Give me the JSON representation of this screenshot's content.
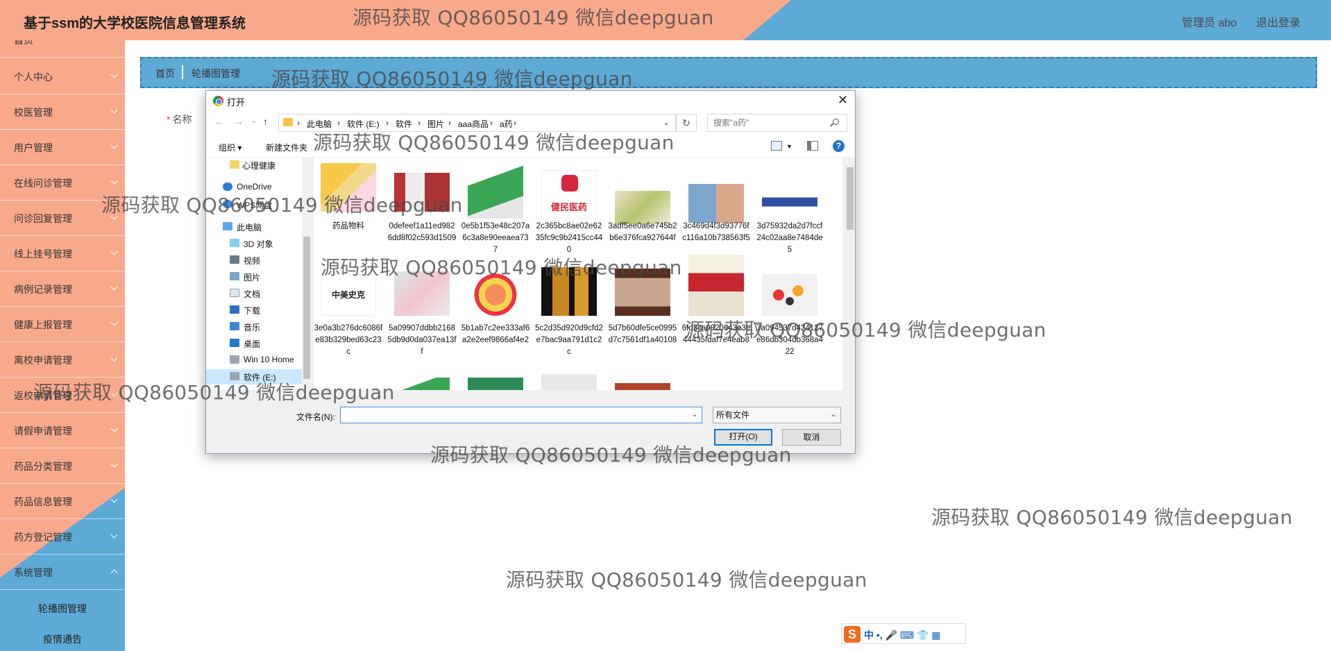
{
  "header": {
    "title": "基于ssm的大学校医院信息管理系统",
    "user": "管理员 abo",
    "logout": "退出登录"
  },
  "sidebar": {
    "items": [
      {
        "label": "首页"
      },
      {
        "label": "个人中心"
      },
      {
        "label": "校医管理"
      },
      {
        "label": "用户管理"
      },
      {
        "label": "在线问诊管理"
      },
      {
        "label": "问诊回复管理"
      },
      {
        "label": "线上挂号管理"
      },
      {
        "label": "病例记录管理"
      },
      {
        "label": "健康上报管理"
      },
      {
        "label": "离校申请管理"
      },
      {
        "label": "返校申请管理"
      },
      {
        "label": "请假申请管理"
      },
      {
        "label": "药品分类管理"
      },
      {
        "label": "药品信息管理"
      },
      {
        "label": "药方登记管理"
      },
      {
        "label": "系统管理"
      }
    ],
    "subitems": [
      {
        "label": "轮播图管理"
      },
      {
        "label": "疫情通告"
      }
    ]
  },
  "breadcrumb": {
    "home": "首页",
    "current": "轮播图管理"
  },
  "form": {
    "name_label": "名称",
    "required_mark": "*"
  },
  "dialog": {
    "title": "打开",
    "close": "✕",
    "nav": {
      "back": "←",
      "forward": "→",
      "recent": "⌄",
      "up": "↑"
    },
    "address": [
      "此电脑",
      "软件 (E:)",
      "软件",
      "图片",
      "aaa商品",
      "a药"
    ],
    "address_sep": "›",
    "refresh": "↻",
    "search_placeholder": "搜索\"a药\"",
    "toolbar": {
      "organize": "组织 ▾",
      "new_folder": "新建文件夹",
      "help": "?"
    },
    "tree": [
      {
        "label": "心理健康",
        "icon": "folder-icon"
      },
      {
        "label": "OneDrive",
        "icon": "cloud-icon"
      },
      {
        "label": "WPS网盘",
        "icon": "cloud-icon"
      },
      {
        "label": "此电脑",
        "icon": "computer-icon"
      },
      {
        "label": "3D 对象",
        "icon": "cube-icon"
      },
      {
        "label": "视频",
        "icon": "video-icon"
      },
      {
        "label": "图片",
        "icon": "image-icon"
      },
      {
        "label": "文档",
        "icon": "document-icon"
      },
      {
        "label": "下载",
        "icon": "download-icon"
      },
      {
        "label": "音乐",
        "icon": "music-icon"
      },
      {
        "label": "桌面",
        "icon": "desktop-icon"
      },
      {
        "label": "Win 10 Home",
        "icon": "drive-icon"
      },
      {
        "label": "软件 (E:)",
        "icon": "drive-icon"
      }
    ],
    "files": [
      {
        "name": "药品物料"
      },
      {
        "name": "0defeef1a11ed9826dd8f02c593d1509"
      },
      {
        "name": "0e5b1f53e48c207a6c3a8e90eeaea737"
      },
      {
        "name": "2c365bc8ae02e6235fc9c9b2415cc440"
      },
      {
        "name": "3adf5ee0a6e745b2b6e376fca927644f"
      },
      {
        "name": "3c469d4f3d93776fc116a10b738563f5"
      },
      {
        "name": "3d75932da2d7fccf24c02aa8e7484de5"
      },
      {
        "name": "3e0a3b276dc6086fe83b329bed63c23c"
      },
      {
        "name": "5a09907ddbb21685db9d0da037ea13ff"
      },
      {
        "name": "5b1ab7c2ee333af6a2e2eef9866af4e2"
      },
      {
        "name": "5c2d35d920d9cfd2e7bac9aa791d1c2c"
      },
      {
        "name": "5d7b60dfe5ce0995d7c7561df1a40108"
      },
      {
        "name": "6fd3ca0920643e3e44435fdaf7e4eab8"
      },
      {
        "name": "7a094537d424127e86db304db368a422"
      }
    ],
    "thumb_texts": {
      "brand_jianmin": "健民医药",
      "brand_zhongmei": "中美史克"
    },
    "filename_label": "文件名(N):",
    "filename_value": "",
    "filter": "所有文件",
    "open_button": "打开(O)",
    "cancel_button": "取消"
  },
  "watermark": "源码获取 QQ86050149 微信deepguan",
  "ime": {
    "text": "中 •, 🎤 ⌨ 👕 ▦",
    "logo": "S"
  }
}
